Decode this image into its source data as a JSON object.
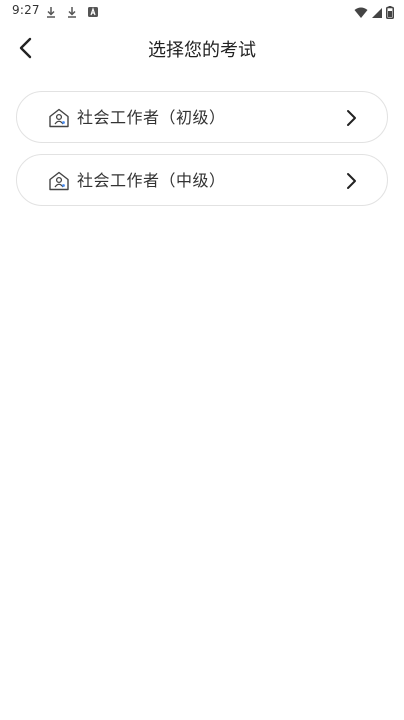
{
  "status_bar": {
    "time": "9:27",
    "left_icons": [
      "download-icon",
      "download-icon",
      "app-notification-icon"
    ],
    "right_icons": [
      "wifi-icon",
      "cellular-signal-icon",
      "battery-icon"
    ]
  },
  "header": {
    "title": "选择您的考试",
    "back_icon": "back-arrow-icon"
  },
  "exams": [
    {
      "label": "社会工作者（初级）",
      "icon": "house-person-icon"
    },
    {
      "label": "社会工作者（中级）",
      "icon": "house-person-icon"
    }
  ],
  "colors": {
    "background": "#ffffff",
    "card_border": "#e2e2e2",
    "text": "#333333"
  }
}
